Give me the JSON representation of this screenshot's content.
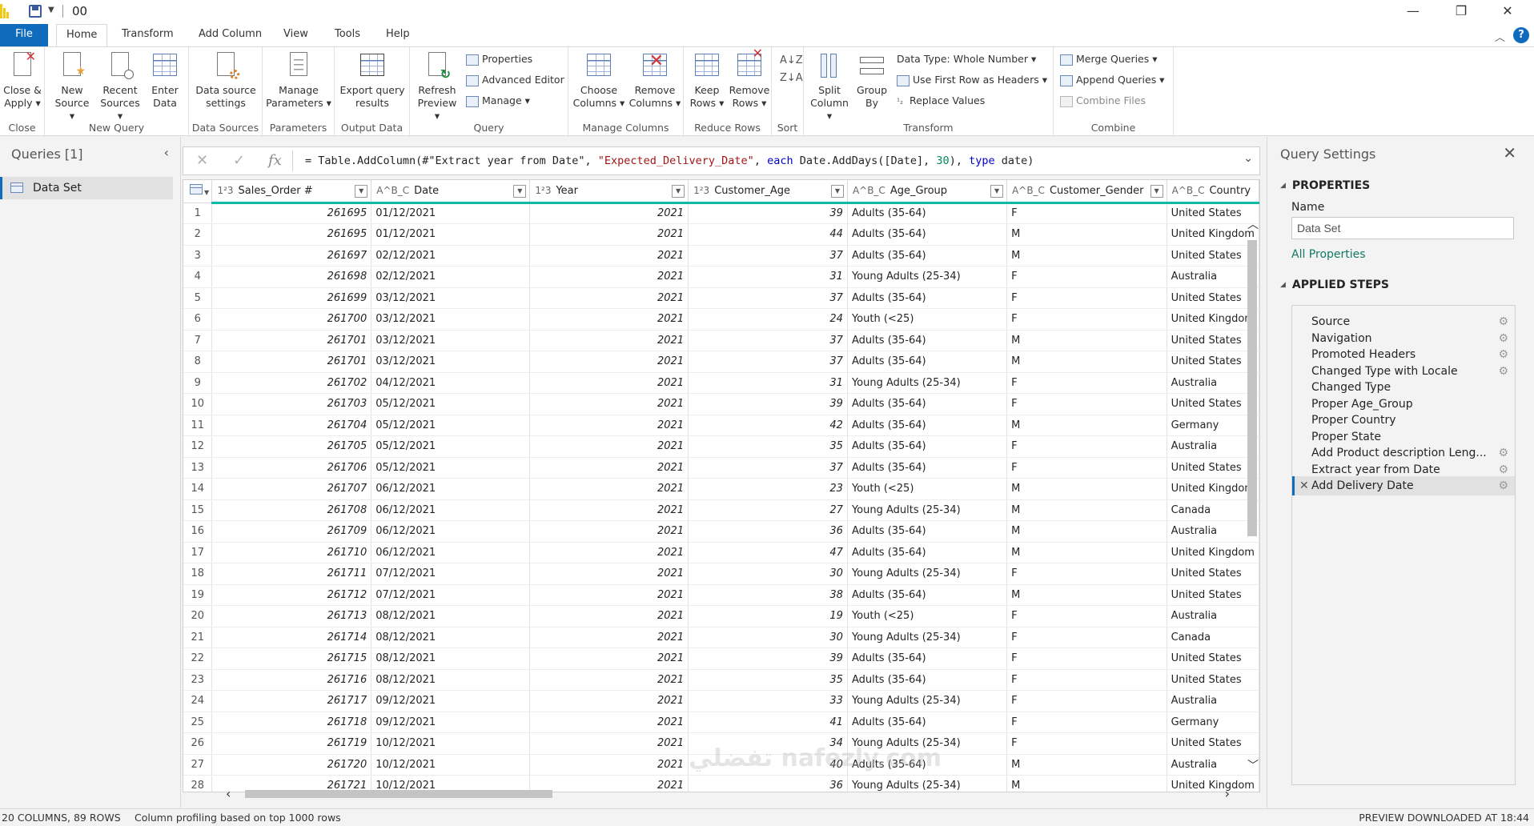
{
  "titlebar": {
    "title": "00",
    "minimize": "—",
    "restore": "❐",
    "close": "✕"
  },
  "tabs": [
    "File",
    "Home",
    "Transform",
    "Add Column",
    "View",
    "Tools",
    "Help"
  ],
  "ribbon": {
    "close_apply": "Close &\nApply ▾",
    "new_source": "New\nSource ▾",
    "recent_sources": "Recent\nSources ▾",
    "enter_data": "Enter\nData",
    "data_source_settings": "Data source\nsettings",
    "manage_parameters": "Manage\nParameters ▾",
    "export_query_results": "Export query\nresults",
    "refresh_preview": "Refresh\nPreview ▾",
    "properties": "Properties",
    "advanced_editor": "Advanced Editor",
    "manage": "Manage ▾",
    "choose_columns": "Choose\nColumns ▾",
    "remove_columns": "Remove\nColumns ▾",
    "keep_rows": "Keep\nRows ▾",
    "remove_rows": "Remove\nRows ▾",
    "split_column": "Split\nColumn ▾",
    "group_by": "Group\nBy",
    "data_type": "Data Type: Whole Number ▾",
    "first_row_headers": "Use First Row as Headers ▾",
    "replace_values": "Replace Values",
    "merge_queries": "Merge Queries ▾",
    "append_queries": "Append Queries ▾",
    "combine_files": "Combine Files",
    "groups": {
      "close": "Close",
      "new_query": "New Query",
      "data_sources": "Data Sources",
      "parameters": "Parameters",
      "output_data": "Output Data",
      "query": "Query",
      "manage_columns": "Manage Columns",
      "reduce_rows": "Reduce Rows",
      "sort": "Sort",
      "transform": "Transform",
      "combine": "Combine"
    }
  },
  "queries_pane": {
    "title": "Queries [1]",
    "items": [
      "Data Set"
    ]
  },
  "formula": {
    "prefix": "= Table.AddColumn(#\"Extract year from Date\", ",
    "str1": "\"Expected_Delivery_Date\"",
    "mid1": ", ",
    "kw_each": "each",
    "mid2": " Date.AddDays([Date], ",
    "num": "30",
    "mid3": "), ",
    "kw_type": "type",
    "suffix": " date)"
  },
  "columns": [
    {
      "type": "1²3",
      "name": "Sales_Order #"
    },
    {
      "type": "A^B_C",
      "name": "Date"
    },
    {
      "type": "1²3",
      "name": "Year"
    },
    {
      "type": "1²3",
      "name": "Customer_Age"
    },
    {
      "type": "A^B_C",
      "name": "Age_Group"
    },
    {
      "type": "A^B_C",
      "name": "Customer_Gender"
    },
    {
      "type": "A^B_C",
      "name": "Country"
    }
  ],
  "rows": [
    [
      "261695",
      "01/12/2021",
      "2021",
      "39",
      "Adults (35-64)",
      "F",
      "United States"
    ],
    [
      "261695",
      "01/12/2021",
      "2021",
      "44",
      "Adults (35-64)",
      "M",
      "United Kingdom"
    ],
    [
      "261697",
      "02/12/2021",
      "2021",
      "37",
      "Adults (35-64)",
      "M",
      "United States"
    ],
    [
      "261698",
      "02/12/2021",
      "2021",
      "31",
      "Young Adults (25-34)",
      "F",
      "Australia"
    ],
    [
      "261699",
      "03/12/2021",
      "2021",
      "37",
      "Adults (35-64)",
      "F",
      "United States"
    ],
    [
      "261700",
      "03/12/2021",
      "2021",
      "24",
      "Youth (<25)",
      "F",
      "United Kingdom"
    ],
    [
      "261701",
      "03/12/2021",
      "2021",
      "37",
      "Adults (35-64)",
      "M",
      "United States"
    ],
    [
      "261701",
      "03/12/2021",
      "2021",
      "37",
      "Adults (35-64)",
      "M",
      "United States"
    ],
    [
      "261702",
      "04/12/2021",
      "2021",
      "31",
      "Young Adults (25-34)",
      "F",
      "Australia"
    ],
    [
      "261703",
      "05/12/2021",
      "2021",
      "39",
      "Adults (35-64)",
      "F",
      "United States"
    ],
    [
      "261704",
      "05/12/2021",
      "2021",
      "42",
      "Adults (35-64)",
      "M",
      "Germany"
    ],
    [
      "261705",
      "05/12/2021",
      "2021",
      "35",
      "Adults (35-64)",
      "F",
      "Australia"
    ],
    [
      "261706",
      "05/12/2021",
      "2021",
      "37",
      "Adults (35-64)",
      "F",
      "United States"
    ],
    [
      "261707",
      "06/12/2021",
      "2021",
      "23",
      "Youth (<25)",
      "M",
      "United Kingdom"
    ],
    [
      "261708",
      "06/12/2021",
      "2021",
      "27",
      "Young Adults (25-34)",
      "M",
      "Canada"
    ],
    [
      "261709",
      "06/12/2021",
      "2021",
      "36",
      "Adults (35-64)",
      "M",
      "Australia"
    ],
    [
      "261710",
      "06/12/2021",
      "2021",
      "47",
      "Adults (35-64)",
      "M",
      "United Kingdom"
    ],
    [
      "261711",
      "07/12/2021",
      "2021",
      "30",
      "Young Adults (25-34)",
      "F",
      "United States"
    ],
    [
      "261712",
      "07/12/2021",
      "2021",
      "38",
      "Adults (35-64)",
      "M",
      "United States"
    ],
    [
      "261713",
      "08/12/2021",
      "2021",
      "19",
      "Youth (<25)",
      "F",
      "Australia"
    ],
    [
      "261714",
      "08/12/2021",
      "2021",
      "30",
      "Young Adults (25-34)",
      "F",
      "Canada"
    ],
    [
      "261715",
      "08/12/2021",
      "2021",
      "39",
      "Adults (35-64)",
      "F",
      "United States"
    ],
    [
      "261716",
      "08/12/2021",
      "2021",
      "35",
      "Adults (35-64)",
      "F",
      "United States"
    ],
    [
      "261717",
      "09/12/2021",
      "2021",
      "33",
      "Young Adults (25-34)",
      "F",
      "Australia"
    ],
    [
      "261718",
      "09/12/2021",
      "2021",
      "41",
      "Adults (35-64)",
      "F",
      "Germany"
    ],
    [
      "261719",
      "10/12/2021",
      "2021",
      "34",
      "Young Adults (25-34)",
      "F",
      "United States"
    ],
    [
      "261720",
      "10/12/2021",
      "2021",
      "40",
      "Adults (35-64)",
      "M",
      "Australia"
    ],
    [
      "261721",
      "10/12/2021",
      "2021",
      "36",
      "Young Adults (25-34)",
      "M",
      "United Kingdom"
    ]
  ],
  "settings": {
    "title": "Query Settings",
    "properties_header": "PROPERTIES",
    "name_label": "Name",
    "name_value": "Data Set",
    "all_properties": "All Properties",
    "applied_steps_header": "APPLIED STEPS",
    "steps": [
      {
        "label": "Source",
        "gear": true
      },
      {
        "label": "Navigation",
        "gear": true
      },
      {
        "label": "Promoted Headers",
        "gear": true
      },
      {
        "label": "Changed Type with Locale",
        "gear": true
      },
      {
        "label": "Changed Type",
        "gear": false
      },
      {
        "label": "Proper Age_Group",
        "gear": false
      },
      {
        "label": "Proper Country",
        "gear": false
      },
      {
        "label": "Proper State",
        "gear": false
      },
      {
        "label": "Add Product description Leng...",
        "gear": true
      },
      {
        "label": "Extract year from Date",
        "gear": true
      },
      {
        "label": "Add Delivery Date",
        "gear": true,
        "active": true
      }
    ]
  },
  "status": {
    "columns_rows": "20 COLUMNS, 89 ROWS",
    "profiling": "Column profiling based on top 1000 rows",
    "preview": "PREVIEW DOWNLOADED AT 18:44"
  },
  "watermark": "تفضلي  nafezly.com",
  "colors": {
    "accent": "#0f6cbd",
    "header_underline": "#0eb9a7",
    "link": "#117865"
  }
}
